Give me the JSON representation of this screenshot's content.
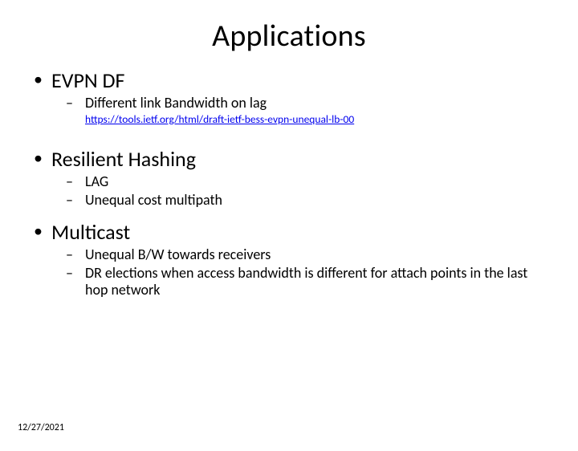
{
  "slide": {
    "title": "Applications",
    "items": [
      {
        "label": "EVPN DF",
        "children": [
          {
            "label": "Different link Bandwidth on lag"
          }
        ],
        "link": "https://tools.ietf.org/html/draft-ietf-bess-evpn-unequal-lb-00"
      },
      {
        "label": "Resilient Hashing",
        "children": [
          {
            "label": "LAG"
          },
          {
            "label": "Unequal cost multipath"
          }
        ]
      },
      {
        "label": "Multicast",
        "children": [
          {
            "label": "Unequal B/W towards receivers"
          },
          {
            "label": "DR elections when access bandwidth is different for attach points in the last hop network"
          }
        ]
      }
    ],
    "footer_date": "12/27/2021"
  }
}
